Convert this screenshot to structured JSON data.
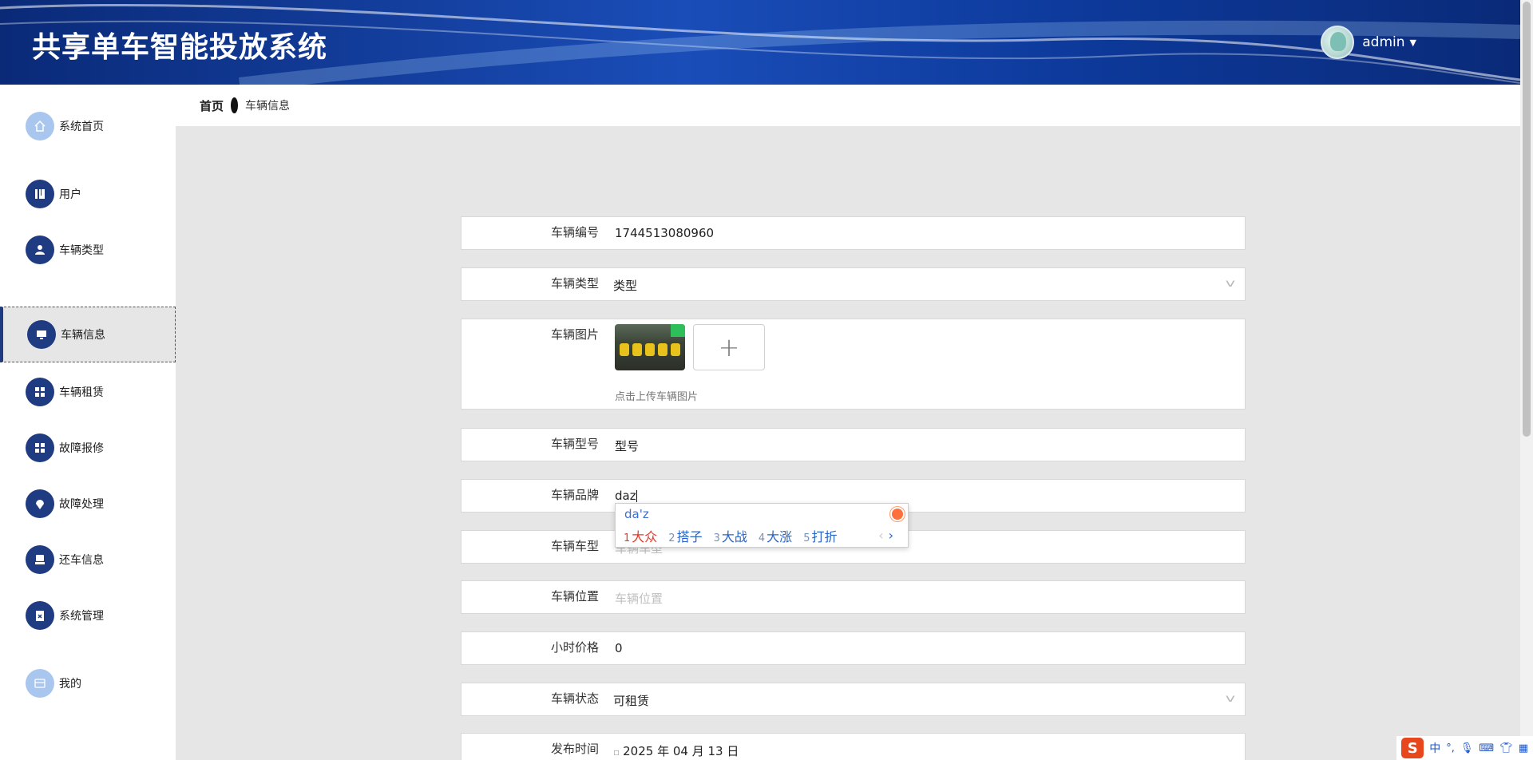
{
  "header": {
    "title": "共享单车智能投放系统",
    "username": "admin"
  },
  "breadcrumb": {
    "home": "首页",
    "current": "车辆信息"
  },
  "sidebar": {
    "items": [
      {
        "label": "系统首页",
        "icon": "home-icon"
      },
      {
        "label": "用户",
        "icon": "book-icon"
      },
      {
        "label": "车辆类型",
        "icon": "person-icon"
      },
      {
        "label": "车辆信息",
        "icon": "monitor-icon",
        "active": true
      },
      {
        "label": "车辆租赁",
        "icon": "grid-icon"
      },
      {
        "label": "故障报修",
        "icon": "grid-icon"
      },
      {
        "label": "故障处理",
        "icon": "location-icon"
      },
      {
        "label": "还车信息",
        "icon": "printer-icon"
      },
      {
        "label": "系统管理",
        "icon": "clipboard-icon"
      },
      {
        "label": "我的",
        "icon": "card-icon"
      }
    ]
  },
  "form": {
    "vehicle_no": {
      "label": "车辆编号",
      "value": "1744513080960"
    },
    "vehicle_type": {
      "label": "车辆类型",
      "value": "类型"
    },
    "vehicle_image": {
      "label": "车辆图片",
      "hint": "点击上传车辆图片"
    },
    "vehicle_model": {
      "label": "车辆型号",
      "value": "型号"
    },
    "vehicle_brand": {
      "label": "车辆品牌",
      "value": "daz"
    },
    "vehicle_kind": {
      "label": "车辆车型",
      "placeholder": "车辆车型"
    },
    "vehicle_location": {
      "label": "车辆位置",
      "placeholder": "车辆位置"
    },
    "hourly_price": {
      "label": "小时价格",
      "value": "0"
    },
    "vehicle_status": {
      "label": "车辆状态",
      "value": "可租赁"
    },
    "publish_time": {
      "label": "发布时间",
      "value": "2025 年 04 月 13 日"
    }
  },
  "ime_popup": {
    "composition": "da'z",
    "candidates": [
      {
        "num": "1",
        "text": "大众"
      },
      {
        "num": "2",
        "text": "搭子"
      },
      {
        "num": "3",
        "text": "大战"
      },
      {
        "num": "4",
        "text": "大涨"
      },
      {
        "num": "5",
        "text": "打折"
      }
    ],
    "prev": "‹",
    "next": "›"
  },
  "ime_bar": {
    "logo": "S",
    "mode": "中"
  },
  "colors": {
    "header": "#0d3a9c",
    "nav_icon": "#1f3b82",
    "background": "#e6e6e6"
  }
}
